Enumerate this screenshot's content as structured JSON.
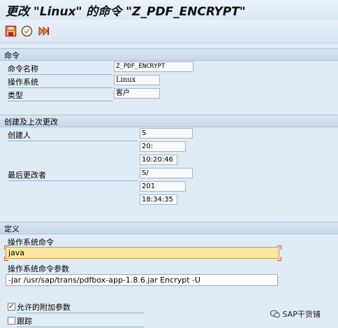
{
  "title": "更改 \"Linux\" 的命令 \"Z_PDF_ENCRYPT\"",
  "toolbar": {
    "save_icon": "save-icon",
    "check_icon": "check-icon",
    "execute_icon": "execute-icon"
  },
  "command_section": {
    "header": "命令",
    "name_label": "命令名称",
    "name_value": "Z_PDF_ENCRYPT",
    "os_label": "操作系统",
    "os_value": "Linux",
    "type_label": "类型",
    "type_value": "客户"
  },
  "created_section": {
    "header": "创建及上次更改",
    "creator_label": "创建人",
    "creator_value": "S",
    "created_date": "20:",
    "created_time": "10:20:46",
    "last_changed_label": "最后更改者",
    "last_changed_value": "S/",
    "changed_date": "201",
    "changed_time": "18:34:35"
  },
  "definition_section": {
    "header": "定义",
    "os_command_label": "操作系统命令",
    "os_command_value": "java",
    "os_params_label": "操作系统命令参数",
    "os_params_value": "-jar /usr/sap/trans/pdfbox-app-1.8.6.jar Encrypt -U",
    "allow_params_label": "允许的附加参数",
    "allow_params_checked": true,
    "allow_params_mark": "✓",
    "trace_label": "跟踪",
    "trace_checked": false
  },
  "watermark": "SAP干货铺"
}
